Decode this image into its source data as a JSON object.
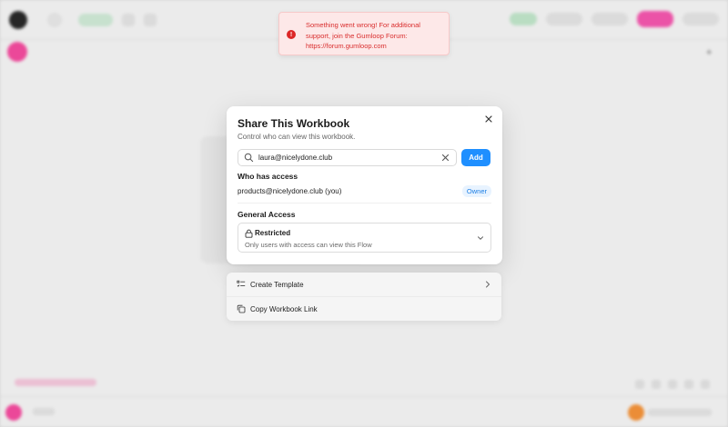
{
  "toast": {
    "message": "Something went wrong! For additional support, join the Gumloop Forum: https://forum.gumloop.com"
  },
  "modal": {
    "title": "Share This Workbook",
    "subtitle": "Control who can view this workbook.",
    "email_value": "laura@nicelydone.club",
    "add_label": "Add",
    "who_has_access_heading": "Who has access",
    "users": [
      {
        "email": "products@nicelydone.club (you)",
        "role": "Owner"
      }
    ],
    "general_access_heading": "General Access",
    "access": {
      "level": "Restricted",
      "description": "Only users with access can view this Flow"
    }
  },
  "menu": {
    "items": [
      {
        "label": "Create Template",
        "icon": "template-icon"
      },
      {
        "label": "Copy Workbook Link",
        "icon": "copy-icon"
      }
    ]
  },
  "colors": {
    "primary": "#1f8fff",
    "error": "#dc2626",
    "brand_pink": "#ff4fa6"
  }
}
